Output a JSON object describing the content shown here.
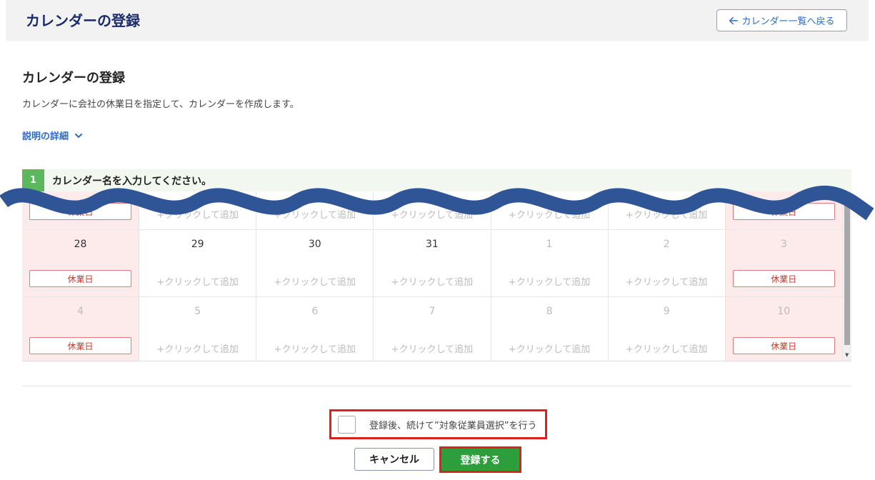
{
  "header": {
    "title": "カレンダーの登録",
    "back_label": "カレンダー一覧へ戻る"
  },
  "section": {
    "title": "カレンダーの登録",
    "description": "カレンダーに会社の休業日を指定して、カレンダーを作成します。",
    "detail_link": "説明の詳細"
  },
  "step": {
    "number": "1",
    "text": "カレンダー名を入力してください。"
  },
  "calendar": {
    "add_label": "+クリックして追加",
    "holiday_label": "休業日",
    "partial_row": [
      {
        "day": "",
        "holiday": true,
        "label": "休業日"
      },
      {
        "day": "",
        "holiday": false,
        "label": "+クリックして追加"
      },
      {
        "day": "",
        "holiday": false,
        "label": "+クリックして追加"
      },
      {
        "day": "",
        "holiday": false,
        "label": "+クリックして追加"
      },
      {
        "day": "",
        "holiday": false,
        "label": "+クリックして追加"
      },
      {
        "day": "",
        "holiday": false,
        "label": "+クリックして追加"
      },
      {
        "day": "",
        "holiday": true,
        "label": "休業日"
      }
    ],
    "weeks": [
      [
        {
          "day": "28",
          "current": true,
          "holiday": true
        },
        {
          "day": "29",
          "current": true,
          "holiday": false
        },
        {
          "day": "30",
          "current": true,
          "holiday": false
        },
        {
          "day": "31",
          "current": true,
          "holiday": false
        },
        {
          "day": "1",
          "current": false,
          "holiday": false
        },
        {
          "day": "2",
          "current": false,
          "holiday": false
        },
        {
          "day": "3",
          "current": false,
          "holiday": true
        }
      ],
      [
        {
          "day": "4",
          "current": false,
          "holiday": true
        },
        {
          "day": "5",
          "current": false,
          "holiday": false
        },
        {
          "day": "6",
          "current": false,
          "holiday": false
        },
        {
          "day": "7",
          "current": false,
          "holiday": false
        },
        {
          "day": "8",
          "current": false,
          "holiday": false
        },
        {
          "day": "9",
          "current": false,
          "holiday": false
        },
        {
          "day": "10",
          "current": false,
          "holiday": true
        }
      ]
    ]
  },
  "footer": {
    "continue_label": "登録後、続けて”対象従業員選択”を行う",
    "cancel_label": "キャンセル",
    "submit_label": "登録する"
  },
  "colors": {
    "primary": "#1a2a6c",
    "link": "#2d6bc4",
    "holiday_bg": "#fdeaea",
    "holiday_text": "#c0392b",
    "submit": "#2e9d3c",
    "highlight": "#e02020",
    "wave": "#2f5597"
  }
}
